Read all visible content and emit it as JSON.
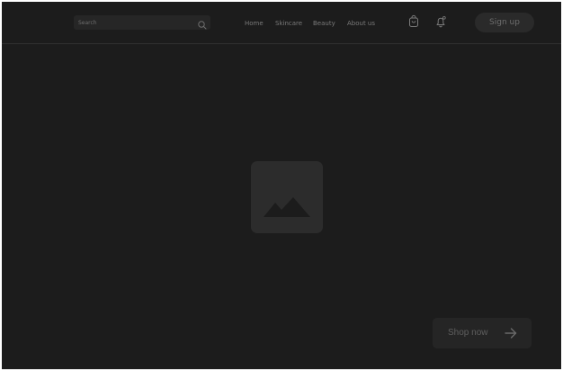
{
  "header": {
    "search": {
      "placeholder": "Search",
      "icon": "search-icon"
    },
    "nav": [
      {
        "label": "Home"
      },
      {
        "label": "Skincare"
      },
      {
        "label": "Beauty"
      },
      {
        "label": "About us"
      }
    ],
    "icons": {
      "cart": "shopping-bag-icon",
      "notifications": "bell-icon"
    },
    "signup_label": "Sign up"
  },
  "hero": {
    "image_icon": "image-placeholder-icon",
    "cta_label": "Shop now",
    "cta_icon": "arrow-right-icon"
  },
  "colors": {
    "background": "#1c1c1c",
    "surface": "#2c2c2c",
    "text_muted": "#7a7a7a"
  }
}
